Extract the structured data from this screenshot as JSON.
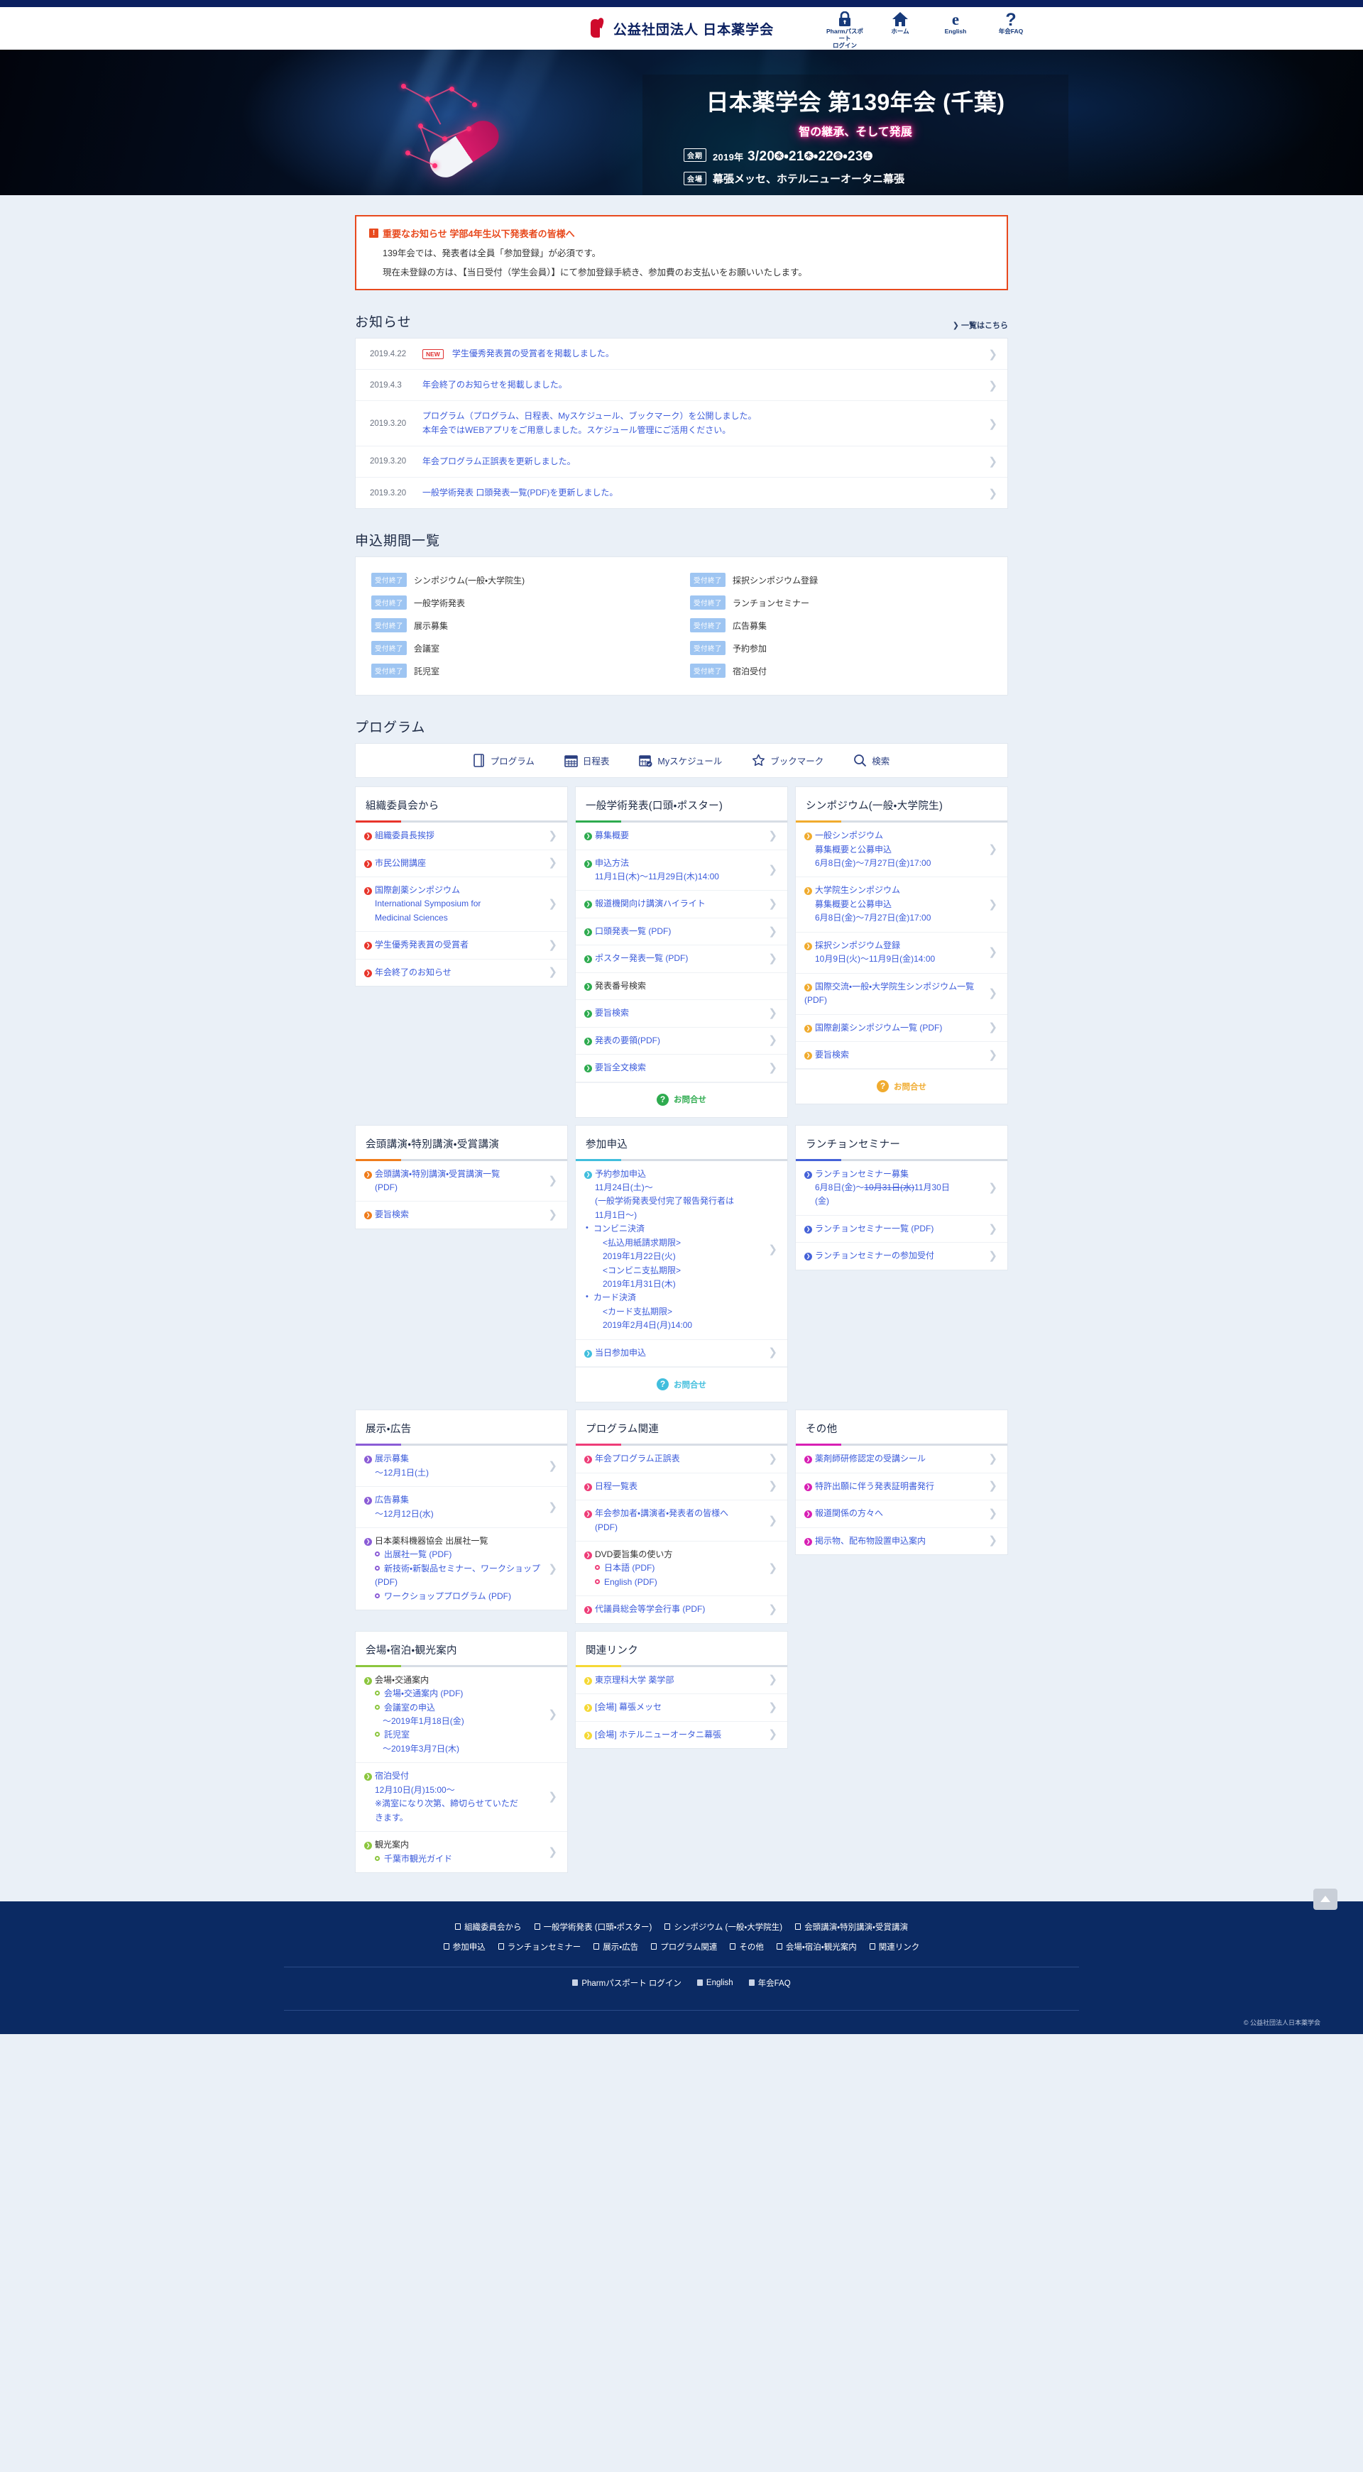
{
  "header": {
    "org_name": "公益社団法人 日本薬学会",
    "tools": [
      {
        "icon": "lock-icon",
        "label": "Pharmパスポート\nログイン"
      },
      {
        "icon": "home-icon",
        "label": "ホーム"
      },
      {
        "icon": "english-e-icon",
        "label": "English"
      },
      {
        "icon": "question-icon",
        "label": "年会FAQ"
      }
    ]
  },
  "hero": {
    "title": "日本薬学会 第139年会 (千葉)",
    "subtitle": "智の継承、そして発展",
    "date_tag": "会期",
    "date_year": "2019年",
    "date_main": "3/20",
    "date_d1": "水",
    "date_2": "21",
    "date_d2": "木",
    "date_3": "22",
    "date_d3": "金",
    "date_4": "23",
    "date_d4": "土",
    "venue_tag": "会場",
    "venue": "幕張メッセ、ホテルニューオータニ幕張"
  },
  "notice": {
    "mark": "!",
    "title": "重要なお知らせ 学部4年生以下発表者の皆様へ",
    "line1": "139年会では、発表者は全員「参加登録」が必須です。",
    "line2": "現在未登録の方は、【当日受付（学生会員）】にて参加登録手続き、参加費のお支払いをお願いいたします。"
  },
  "news_section": {
    "title": "お知らせ",
    "more": "一覧はこちら",
    "items": [
      {
        "date": "2019.4.22",
        "new": "NEW",
        "text": "学生優秀発表賞の受賞者を掲載しました。",
        "text2": ""
      },
      {
        "date": "2019.4.3",
        "new": "",
        "text": "年会終了のお知らせを掲載しました。",
        "text2": ""
      },
      {
        "date": "2019.3.20",
        "new": "",
        "text": "プログラム（プログラム、日程表、Myスケジュール、ブックマーク）を公開しました。",
        "text2": "本年会ではWEBアプリをご用意しました。スケジュール管理にご活用ください。"
      },
      {
        "date": "2019.3.20",
        "new": "",
        "text": "年会プログラム正誤表を更新しました。",
        "text2": ""
      },
      {
        "date": "2019.3.20",
        "new": "",
        "text": "一般学術発表 口頭発表一覧(PDF)を更新しました。",
        "text2": ""
      }
    ]
  },
  "apply_section": {
    "title": "申込期間一覧",
    "items": [
      {
        "badge": "受付終了",
        "label": "シンポジウム(一般・大学院生)"
      },
      {
        "badge": "受付終了",
        "label": "採択シンポジウム登録"
      },
      {
        "badge": "受付終了",
        "label": "一般学術発表"
      },
      {
        "badge": "受付終了",
        "label": "ランチョンセミナー"
      },
      {
        "badge": "受付終了",
        "label": "展示募集"
      },
      {
        "badge": "受付終了",
        "label": "広告募集"
      },
      {
        "badge": "受付終了",
        "label": "会議室"
      },
      {
        "badge": "受付終了",
        "label": "予約参加"
      },
      {
        "badge": "受付終了",
        "label": "託児室"
      },
      {
        "badge": "受付終了",
        "label": "宿泊受付"
      }
    ]
  },
  "program_section": {
    "title": "プログラム",
    "tabs": [
      {
        "icon": "book-icon",
        "label": "プログラム"
      },
      {
        "icon": "calendar-icon",
        "label": "日程表"
      },
      {
        "icon": "calendar-check-icon",
        "label": "Myスケジュール"
      },
      {
        "icon": "star-icon",
        "label": "ブックマーク"
      },
      {
        "icon": "search-icon",
        "label": "検索"
      }
    ]
  },
  "cards": [
    {
      "title": "組織委員会から",
      "accent": "#e8352b",
      "contact": null,
      "rows": [
        {
          "lines": [
            {
              "text": "組織委員長挨拶",
              "style": "link",
              "bullet": "main"
            }
          ]
        },
        {
          "lines": [
            {
              "text": "市民公開講座",
              "style": "link",
              "bullet": "main"
            }
          ]
        },
        {
          "lines": [
            {
              "text": "国際創薬シンポジウム",
              "style": "link",
              "bullet": "main"
            },
            {
              "text": "International Symposium for",
              "style": "link",
              "indent": 1
            },
            {
              "text": "Medicinal Sciences",
              "style": "link",
              "indent": 1
            }
          ]
        },
        {
          "lines": [
            {
              "text": "学生優秀発表賞の受賞者",
              "style": "link",
              "bullet": "main"
            }
          ]
        },
        {
          "lines": [
            {
              "text": "年会終了のお知らせ",
              "style": "link",
              "bullet": "main"
            }
          ]
        }
      ]
    },
    {
      "title": "一般学術発表(口頭・ポスター)",
      "accent": "#2eab4f",
      "contact": "お問合せ",
      "rows": [
        {
          "lines": [
            {
              "text": "募集概要",
              "style": "link",
              "bullet": "main"
            }
          ]
        },
        {
          "lines": [
            {
              "text": "申込方法",
              "style": "link",
              "bullet": "main"
            },
            {
              "text": "11月1日(木)〜11月29日(木)14:00",
              "style": "link",
              "indent": 1
            }
          ]
        },
        {
          "lines": [
            {
              "text": "報道機関向け講演ハイライト",
              "style": "link",
              "bullet": "main"
            }
          ]
        },
        {
          "lines": [
            {
              "text": "口頭発表一覧 (PDF)",
              "style": "link",
              "bullet": "main"
            }
          ]
        },
        {
          "lines": [
            {
              "text": "ポスター発表一覧 (PDF)",
              "style": "link",
              "bullet": "main"
            }
          ]
        },
        {
          "lines": [
            {
              "text": "発表番号検索",
              "style": "plain",
              "bullet": "main"
            }
          ],
          "nolink": true
        },
        {
          "lines": [
            {
              "text": "要旨検索",
              "style": "link",
              "bullet": "main"
            }
          ]
        },
        {
          "lines": [
            {
              "text": "発表の要領(PDF)",
              "style": "link",
              "bullet": "main"
            }
          ]
        },
        {
          "lines": [
            {
              "text": "要旨全文検索",
              "style": "link",
              "bullet": "main"
            }
          ]
        }
      ]
    },
    {
      "title": "シンポジウム(一般・大学院生)",
      "accent": "#f0ab2e",
      "contact": "お問合せ",
      "rows": [
        {
          "lines": [
            {
              "text": "一般シンポジウム",
              "style": "link",
              "bullet": "main"
            },
            {
              "text": "募集概要と公募申込",
              "style": "link",
              "indent": 1
            },
            {
              "text": "6月8日(金)〜7月27日(金)17:00",
              "style": "link",
              "indent": 1
            }
          ]
        },
        {
          "lines": [
            {
              "text": "大学院生シンポジウム",
              "style": "link",
              "bullet": "main"
            },
            {
              "text": "募集概要と公募申込",
              "style": "link",
              "indent": 1
            },
            {
              "text": "6月8日(金)〜7月27日(金)17:00",
              "style": "link",
              "indent": 1
            }
          ]
        },
        {
          "lines": [
            {
              "text": "採択シンポジウム登録",
              "style": "link",
              "bullet": "main"
            },
            {
              "text": "10月9日(火)〜11月9日(金)14:00",
              "style": "link",
              "indent": 1
            }
          ]
        },
        {
          "lines": [
            {
              "text": "国際交流・一般・大学院生シンポジウム一覧 (PDF)",
              "style": "link",
              "bullet": "main"
            }
          ]
        },
        {
          "lines": [
            {
              "text": "国際創薬シンポジウム一覧 (PDF)",
              "style": "link",
              "bullet": "main"
            }
          ]
        },
        {
          "lines": [
            {
              "text": "要旨検索",
              "style": "link",
              "bullet": "main"
            }
          ]
        }
      ]
    },
    {
      "title": "会頭講演・特別講演・受賞講演",
      "accent": "#ef7c1b",
      "contact": null,
      "rows": [
        {
          "lines": [
            {
              "text": "会頭講演・特別講演・受賞講演一覧",
              "style": "link",
              "bullet": "main"
            },
            {
              "text": "(PDF)",
              "style": "link",
              "indent": 1
            }
          ]
        },
        {
          "lines": [
            {
              "text": "要旨検索",
              "style": "link",
              "bullet": "main"
            }
          ]
        }
      ]
    },
    {
      "title": "参加申込",
      "accent": "#41bedd",
      "contact": "お問合せ",
      "rows": [
        {
          "lines": [
            {
              "text": "予約参加申込",
              "style": "link",
              "bullet": "main"
            },
            {
              "text": "11月24日(土)〜",
              "style": "link",
              "indent": 1
            },
            {
              "text": "(一般学術発表受付完了報告発行者は",
              "style": "link",
              "indent": 1
            },
            {
              "text": "11月1日〜)",
              "style": "link",
              "indent": 1
            },
            {
              "text": "コンビニ決済",
              "style": "link",
              "indent": 1,
              "dot": true
            },
            {
              "text": "<払込用紙請求期限>",
              "style": "link",
              "indent": 2
            },
            {
              "text": "2019年1月22日(火)",
              "style": "link",
              "indent": 2
            },
            {
              "text": "<コンビニ支払期限>",
              "style": "link",
              "indent": 2
            },
            {
              "text": "2019年1月31日(木)",
              "style": "link",
              "indent": 2
            },
            {
              "text": "カード決済",
              "style": "link",
              "indent": 1,
              "dot": true
            },
            {
              "text": "<カード支払期限>",
              "style": "link",
              "indent": 2
            },
            {
              "text": "2019年2月4日(月)14:00",
              "style": "link",
              "indent": 2
            }
          ]
        },
        {
          "lines": [
            {
              "text": "当日参加申込",
              "style": "link",
              "bullet": "main"
            }
          ]
        }
      ]
    },
    {
      "title": "ランチョンセミナー",
      "accent": "#4562d8",
      "contact": null,
      "rows": [
        {
          "lines": [
            {
              "text": "ランチョンセミナー募集",
              "style": "link",
              "bullet": "main"
            },
            {
              "text": "6月8日(金)〜",
              "style": "link",
              "indent": 1,
              "append_strike": "10月31日(水)",
              "append": "11月30日"
            },
            {
              "text": "(金)",
              "style": "link",
              "indent": 1
            }
          ]
        },
        {
          "lines": [
            {
              "text": "ランチョンセミナー一覧 (PDF)",
              "style": "link",
              "bullet": "main"
            }
          ]
        },
        {
          "lines": [
            {
              "text": "ランチョンセミナーの参加受付",
              "style": "link",
              "bullet": "main"
            }
          ]
        }
      ]
    },
    {
      "title": "展示・広告",
      "accent": "#8b5cd6",
      "contact": null,
      "rows": [
        {
          "lines": [
            {
              "text": "展示募集",
              "style": "link",
              "bullet": "main"
            },
            {
              "text": "〜12月1日(土)",
              "style": "link",
              "indent": 1
            }
          ]
        },
        {
          "lines": [
            {
              "text": "広告募集",
              "style": "link",
              "bullet": "main"
            },
            {
              "text": "〜12月12日(水)",
              "style": "link",
              "indent": 1
            }
          ]
        },
        {
          "lines": [
            {
              "text": "日本薬科機器協会 出展社一覧",
              "style": "plain",
              "bullet": "main"
            },
            {
              "text": "出展社一覧 (PDF)",
              "style": "link",
              "indent": 1,
              "bullet": "sub"
            },
            {
              "text": "新技術・新製品セミナー、ワークショップ (PDF)",
              "style": "link",
              "indent": 1,
              "bullet": "sub"
            },
            {
              "text": "ワークショッププログラム (PDF)",
              "style": "link",
              "indent": 1,
              "bullet": "sub"
            }
          ]
        }
      ]
    },
    {
      "title": "プログラム関連",
      "accent": "#ee3d78",
      "contact": null,
      "rows": [
        {
          "lines": [
            {
              "text": "年会プログラム正誤表",
              "style": "link",
              "bullet": "main"
            }
          ]
        },
        {
          "lines": [
            {
              "text": "日程一覧表",
              "style": "link",
              "bullet": "main"
            }
          ]
        },
        {
          "lines": [
            {
              "text": "年会参加者・講演者・発表者の皆様へ",
              "style": "link",
              "bullet": "main"
            },
            {
              "text": "(PDF)",
              "style": "link",
              "indent": 1
            }
          ]
        },
        {
          "lines": [
            {
              "text": "DVD要旨集の使い方",
              "style": "plain",
              "bullet": "main"
            },
            {
              "text": "日本語 (PDF)",
              "style": "link",
              "indent": 1,
              "bullet": "sub"
            },
            {
              "text": "English (PDF)",
              "style": "link",
              "indent": 1,
              "bullet": "sub"
            }
          ]
        },
        {
          "lines": [
            {
              "text": "代議員総会等学会行事 (PDF)",
              "style": "link",
              "bullet": "main"
            }
          ]
        }
      ]
    },
    {
      "title": "その他",
      "accent": "#d81fb4",
      "contact": null,
      "rows": [
        {
          "lines": [
            {
              "text": "薬剤師研修認定の受講シール",
              "style": "link",
              "bullet": "main"
            }
          ]
        },
        {
          "lines": [
            {
              "text": "特許出願に伴う発表証明書発行",
              "style": "link",
              "bullet": "main"
            }
          ]
        },
        {
          "lines": [
            {
              "text": "報道関係の方々へ",
              "style": "link",
              "bullet": "main"
            }
          ]
        },
        {
          "lines": [
            {
              "text": "掲示物、配布物設置申込案内",
              "style": "link",
              "bullet": "main"
            }
          ]
        }
      ]
    },
    {
      "title": "会場・宿泊・観光案内",
      "accent": "#8cc63e",
      "contact": null,
      "rows": [
        {
          "lines": [
            {
              "text": "会場・交通案内",
              "style": "plain",
              "bullet": "main"
            },
            {
              "text": "会場・交通案内 (PDF)",
              "style": "link",
              "indent": 1,
              "bullet": "sub"
            },
            {
              "text": "会議室の申込",
              "style": "link",
              "indent": 1,
              "bullet": "sub"
            },
            {
              "text": "〜2019年1月18日(金)",
              "style": "link",
              "indent": 2
            },
            {
              "text": "託児室",
              "style": "link",
              "indent": 1,
              "bullet": "sub"
            },
            {
              "text": "〜2019年3月7日(木)",
              "style": "link",
              "indent": 2
            }
          ]
        },
        {
          "lines": [
            {
              "text": "宿泊受付",
              "style": "link",
              "bullet": "main"
            },
            {
              "text": "12月10日(月)15:00〜",
              "style": "link",
              "indent": 1
            },
            {
              "text": "※満室になり次第、締切らせていただ",
              "style": "link",
              "indent": 1
            },
            {
              "text": "きます。",
              "style": "link",
              "indent": 1
            }
          ]
        },
        {
          "lines": [
            {
              "text": "観光案内",
              "style": "plain",
              "bullet": "main"
            },
            {
              "text": "千葉市観光ガイド",
              "style": "link",
              "indent": 1,
              "bullet": "sub"
            }
          ]
        }
      ]
    },
    {
      "title": "関連リンク",
      "accent": "#f5d835",
      "contact": null,
      "rows": [
        {
          "lines": [
            {
              "text": "東京理科大学 薬学部",
              "style": "link",
              "bullet": "main"
            }
          ]
        },
        {
          "lines": [
            {
              "text": "[会場] 幕張メッセ",
              "style": "link",
              "bullet": "main"
            }
          ]
        },
        {
          "lines": [
            {
              "text": "[会場] ホテルニューオータニ幕張",
              "style": "link",
              "bullet": "main"
            }
          ]
        }
      ]
    }
  ],
  "footer": {
    "nav_row1": [
      "組織委員会から",
      "一般学術発表 (口頭・ポスター)",
      "シンポジウム (一般・大学院生)",
      "会頭講演・特別講演・受賞講演"
    ],
    "nav_row2": [
      "参加申込",
      "ランチョンセミナー",
      "展示・広告",
      "プログラム関連",
      "その他",
      "会場・宿泊・観光案内",
      "関連リンク"
    ],
    "nav_row3": [
      "Pharmパスポート ログイン",
      "English",
      "年会FAQ"
    ],
    "copyright": "© 公益社団法人日本薬学会",
    "to_top": "▲"
  }
}
